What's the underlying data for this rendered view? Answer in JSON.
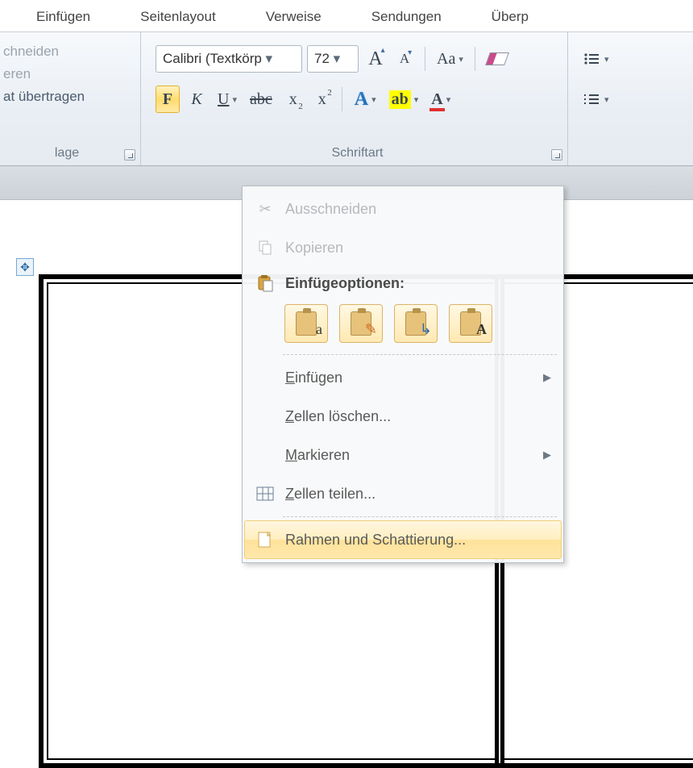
{
  "tabs": {
    "home": "Einfügen",
    "layout": "Seitenlayout",
    "references": "Verweise",
    "mailings": "Sendungen",
    "review": "Überp"
  },
  "clipboard": {
    "cut": "chneiden",
    "copy": "eren",
    "format_painter": "at übertragen",
    "group_label": "lage"
  },
  "font": {
    "name": "Calibri (Textkörp",
    "size": "72",
    "bold": "F",
    "italic": "K",
    "underline": "U",
    "strike": "abc",
    "subscript": "x",
    "superscript": "x",
    "case": "Aa",
    "group_label": "Schriftart"
  },
  "context": {
    "cut": "Ausschneiden",
    "copy": "Kopieren",
    "paste_options": "Einfügeoptionen:",
    "insert": "Einfügen",
    "delete_cells": "Zellen löschen...",
    "select": "Markieren",
    "split_cells": "Zellen teilen...",
    "borders_shading": "Rahmen und Schattierung..."
  }
}
